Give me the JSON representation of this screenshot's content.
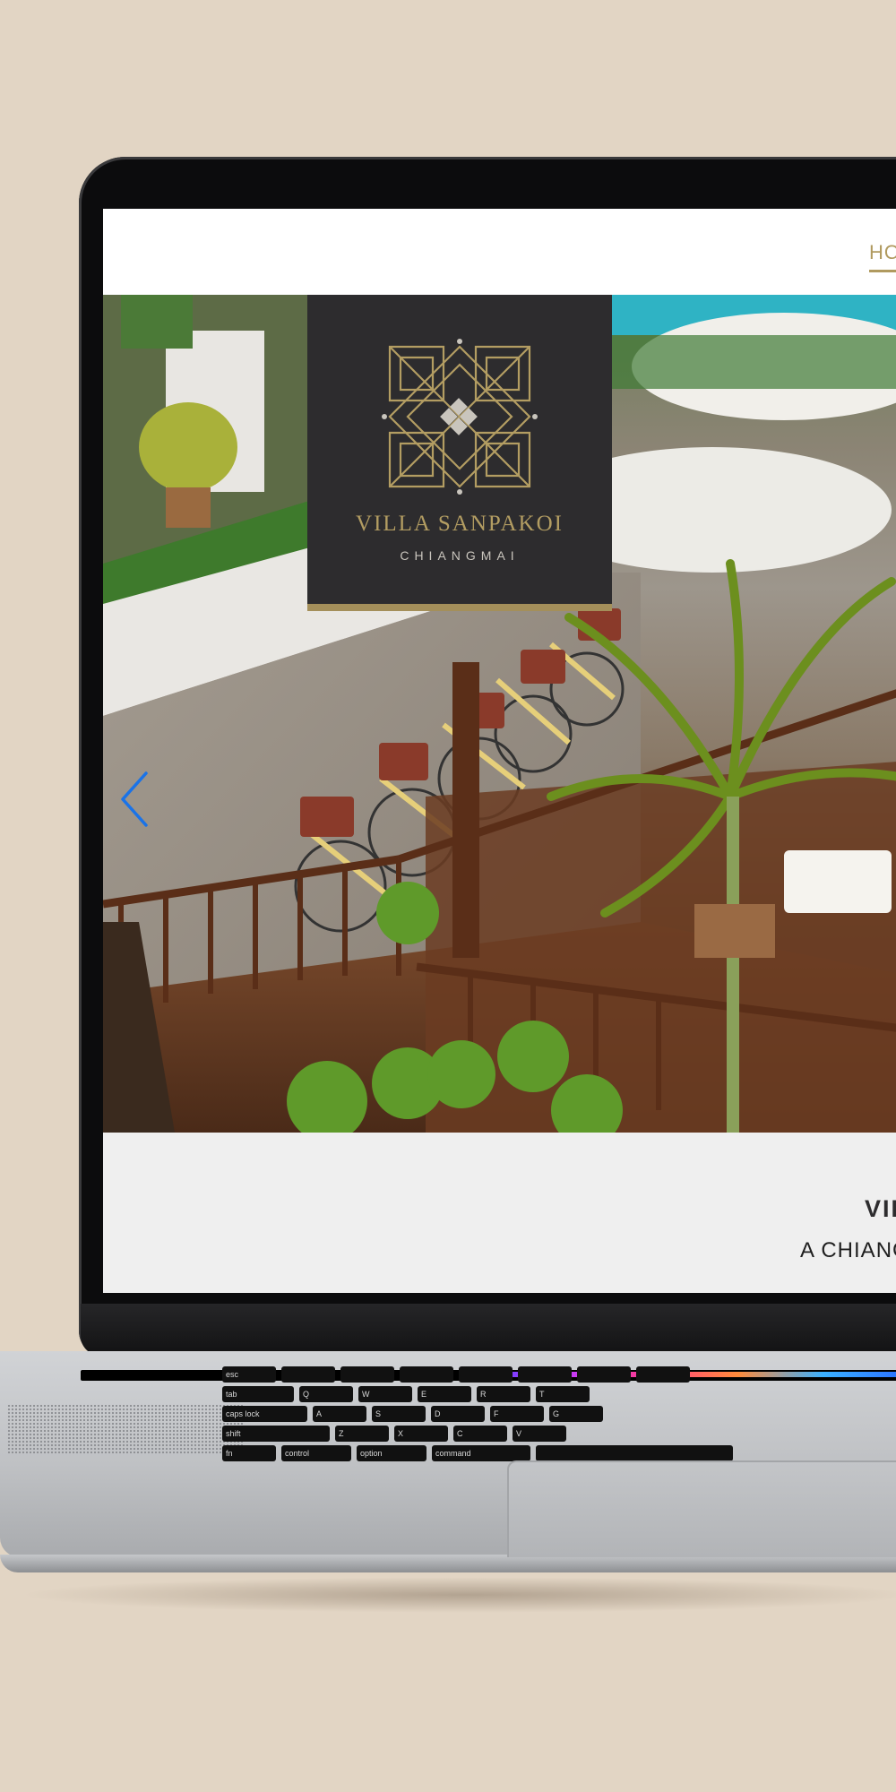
{
  "site": {
    "nav": {
      "home_label": "HO"
    },
    "logo": {
      "title": "VILLA SANPAKOI",
      "subtitle": "CHIANGMAI"
    },
    "intro": {
      "title": "VIL",
      "tagline": "A CHIANG"
    }
  },
  "keyboard": {
    "row1": [
      "esc",
      "",
      "",
      "",
      "",
      "",
      "",
      "",
      ""
    ],
    "row2": [
      "tab",
      "Q",
      "W",
      "E",
      "R",
      "T"
    ],
    "row3": [
      "caps lock",
      "A",
      "S",
      "D",
      "F",
      "G"
    ],
    "row4": [
      "shift",
      "Z",
      "X",
      "C",
      "V"
    ],
    "row5": [
      "fn",
      "control",
      "option",
      "command",
      ""
    ]
  },
  "colors": {
    "background": "#e2d5c4",
    "brand_gold": "#b09a5f",
    "logo_box": "#2d2c2e",
    "arrow_blue": "#1a73e8"
  }
}
